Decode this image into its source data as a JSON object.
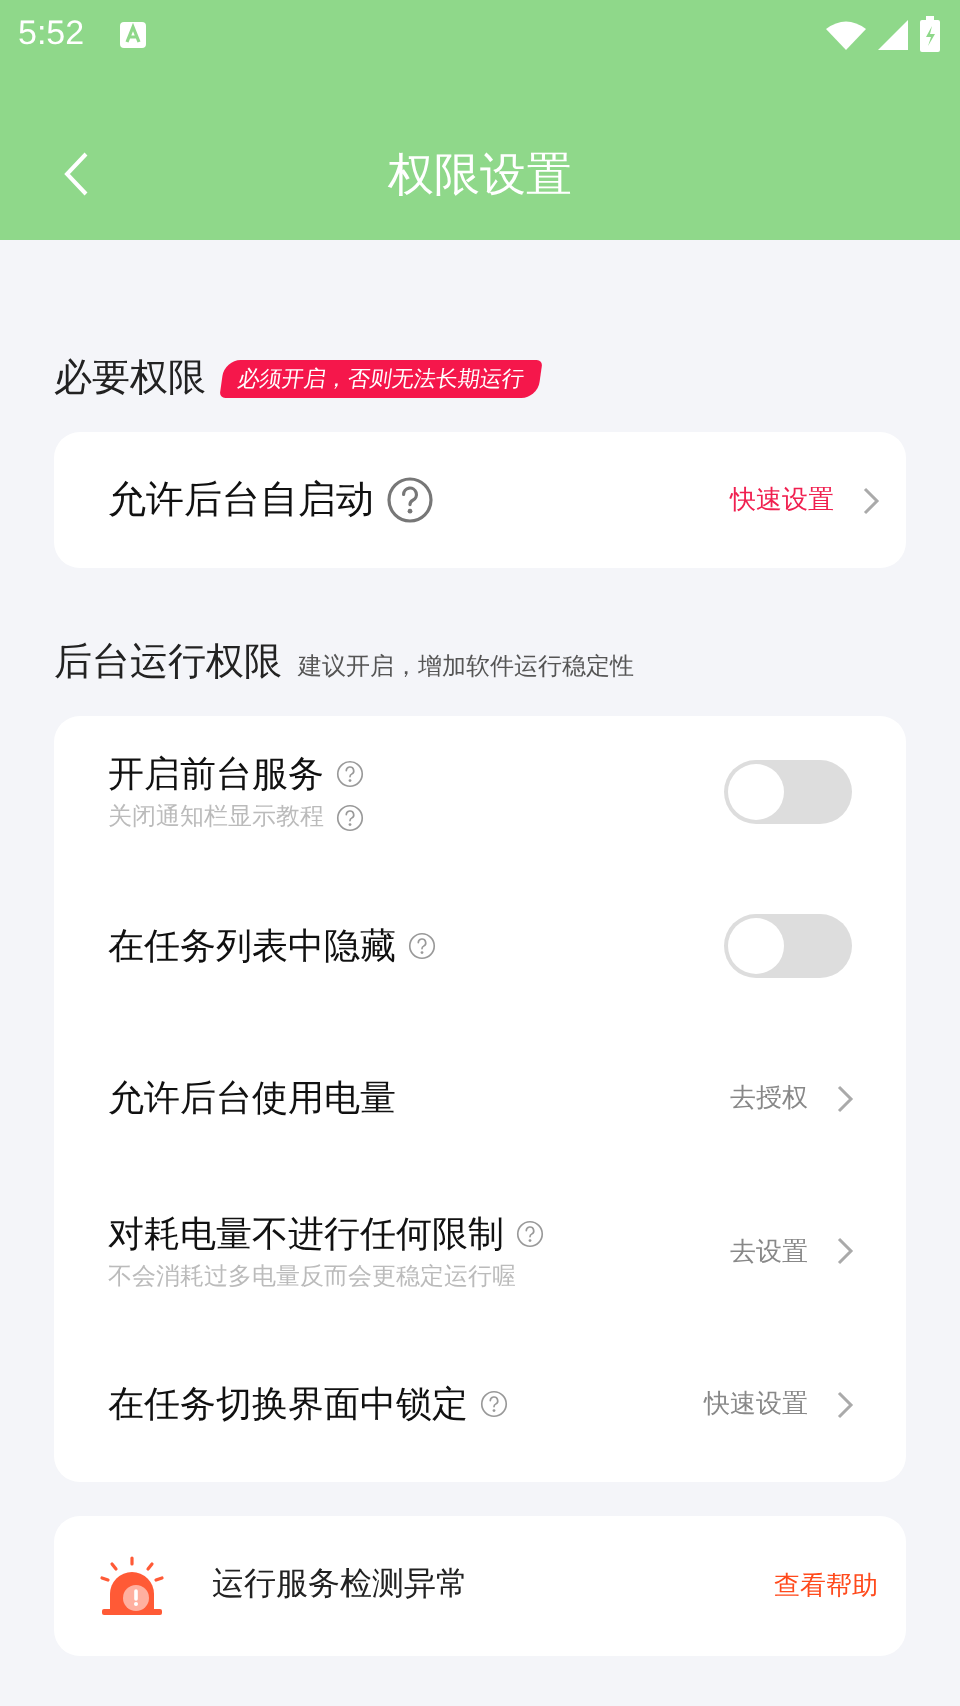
{
  "status_bar": {
    "time": "5:52"
  },
  "header": {
    "title": "权限设置"
  },
  "sections": [
    {
      "title": "必要权限",
      "note": "必须开启，否则无法长期运行",
      "warning": true,
      "rows": [
        {
          "kind": "link",
          "label": "允许后台自启动",
          "help": true,
          "help_large": true,
          "action": "快速设置",
          "highlighted": true
        }
      ]
    },
    {
      "title": "后台运行权限",
      "note": "建议开启，增加软件运行稳定性",
      "warning": false,
      "rows": [
        {
          "kind": "toggle",
          "label": "开启前台服务",
          "help": true,
          "help_large": false,
          "subtitle": "关闭通知栏显示教程",
          "subtitle_help": true,
          "on": false
        },
        {
          "kind": "toggle",
          "label": "在任务列表中隐藏",
          "help": true,
          "help_large": false,
          "on": false
        },
        {
          "kind": "link",
          "label": "允许后台使用电量",
          "help": false,
          "action": "去授权",
          "highlighted": false
        },
        {
          "kind": "link",
          "label": "对耗电量不进行任何限制",
          "help": true,
          "help_large": false,
          "subtitle": "不会消耗过多电量反而会更稳定运行喔",
          "action": "去设置",
          "highlighted": false
        },
        {
          "kind": "link",
          "label": "在任务切换界面中锁定",
          "help": true,
          "help_large": false,
          "action": "快速设置",
          "highlighted": false
        }
      ]
    }
  ],
  "alert": {
    "message": "运行服务检测异常",
    "action": "查看帮助"
  }
}
